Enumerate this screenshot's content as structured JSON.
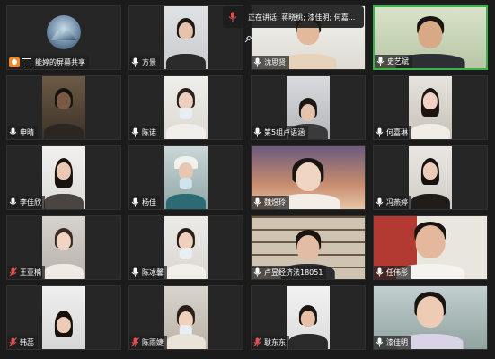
{
  "speaking_banner": {
    "text": "正在讲话: 蒋晓桃; 漆佳明; 何嘉..."
  },
  "tiles": [
    {
      "name": "能婷的屏幕共享",
      "kind": "share"
    },
    {
      "name": "方景"
    },
    {
      "name": "沈思贤"
    },
    {
      "name": "史艺斌",
      "active": true
    },
    {
      "name": "申晴"
    },
    {
      "name": "陈诺"
    },
    {
      "name": "第5组卢语涵"
    },
    {
      "name": "何嘉琳"
    },
    {
      "name": "李佳欣"
    },
    {
      "name": "杨佳"
    },
    {
      "name": "魏煜玲"
    },
    {
      "name": "冯燕婷"
    },
    {
      "name": "王亚楠"
    },
    {
      "name": "陈冰馨"
    },
    {
      "name": "卢昱经济法18051"
    },
    {
      "name": "任伟彤"
    },
    {
      "name": "韩蕊"
    },
    {
      "name": "陈雨婕"
    },
    {
      "name": "耿东东"
    },
    {
      "name": "漆佳明"
    }
  ],
  "colors": {
    "background": "#1b1b1b",
    "tile": "#262626",
    "active_border": "#38b24a",
    "muted_mic": "#e05050"
  }
}
